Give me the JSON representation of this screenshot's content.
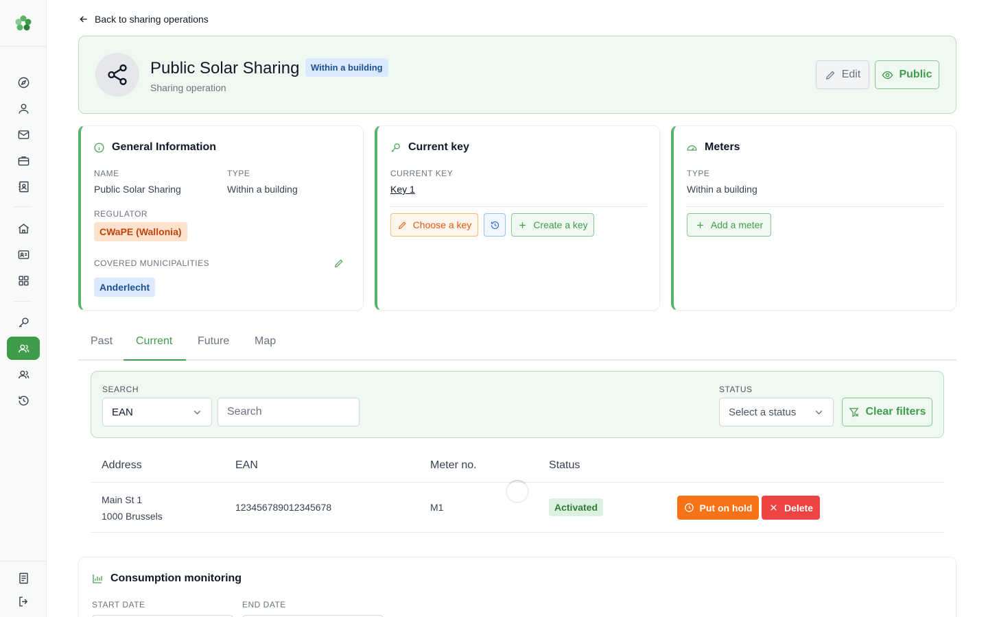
{
  "back_link": "Back to sharing operations",
  "header": {
    "title": "Public Solar Sharing",
    "badge": "Within a building",
    "subtitle": "Sharing operation",
    "edit_label": "Edit",
    "public_label": "Public"
  },
  "general": {
    "title": "General Information",
    "name_label": "NAME",
    "name_value": "Public Solar Sharing",
    "type_label": "TYPE",
    "type_value": "Within a building",
    "regulator_label": "REGULATOR",
    "regulator_value": "CWaPE (Wallonia)",
    "municipalities_label": "COVERED MUNICIPALITIES",
    "municipality": "Anderlecht"
  },
  "key": {
    "title": "Current key",
    "current_label": "CURRENT KEY",
    "current_value": "Key 1",
    "choose_label": "Choose a key",
    "create_label": "Create a key"
  },
  "meters": {
    "title": "Meters",
    "type_label": "TYPE",
    "type_value": "Within a building",
    "add_label": "Add a meter"
  },
  "tabs": [
    {
      "label": "Past"
    },
    {
      "label": "Current"
    },
    {
      "label": "Future"
    },
    {
      "label": "Map"
    }
  ],
  "active_tab": "Current",
  "filters": {
    "search_label": "SEARCH",
    "search_field": "EAN",
    "search_placeholder": "Search",
    "status_label": "STATUS",
    "status_placeholder": "Select a status",
    "clear_label": "Clear filters"
  },
  "table": {
    "headers": [
      "Address",
      "EAN",
      "Meter no.",
      "Status"
    ],
    "rows": [
      {
        "address_line1": "Main St 1",
        "address_line2": "1000 Brussels",
        "ean": "123456789012345678",
        "meter_no": "M1",
        "status": "Activated",
        "hold_label": "Put on hold",
        "delete_label": "Delete"
      }
    ]
  },
  "consumption": {
    "title": "Consumption monitoring",
    "start_label": "START DATE",
    "end_label": "END DATE"
  },
  "colors": {
    "brand_green": "#3e9c4a",
    "orange": "#f97316",
    "red": "#ef4444",
    "blue_badge": "#dbeafe"
  }
}
